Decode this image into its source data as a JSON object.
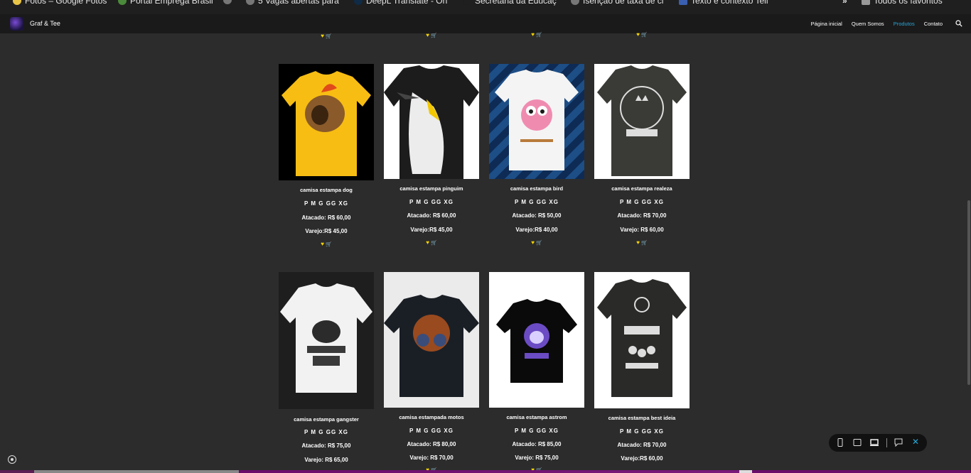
{
  "bookmarks": [
    {
      "label": "Fotos – Google Fotos"
    },
    {
      "label": "Portal Emprega Brasil"
    },
    {
      "label": ""
    },
    {
      "label": "5 Vagas abertas para"
    },
    {
      "label": "DeepL Translate - On"
    },
    {
      "label": "Secretaria da Educaç"
    },
    {
      "label": "Isenção de taxa de ci"
    },
    {
      "label": "Texto e contexto Teli"
    }
  ],
  "bookmarks_more": "»",
  "all_bookmarks": "Todos os favoritos",
  "site": {
    "brand": "Graf & Tee"
  },
  "nav": [
    {
      "label": "Página inicial",
      "active": false
    },
    {
      "label": "Quem Somos",
      "active": false
    },
    {
      "label": "Produtos",
      "active": true
    },
    {
      "label": "Contato",
      "active": false
    }
  ],
  "products": [
    {
      "name": "camisa estampa dog",
      "sizes": "P M G GG XG",
      "atacado": "Atacado: R$ 60,00",
      "varejo": "Varejo:R$ 45,00",
      "image": "yellow-tshirt-dog-print"
    },
    {
      "name": "camisa estampa pinguim",
      "sizes": "P M G GG XG",
      "atacado": "Atacado: R$ 60,00",
      "varejo": "Varejo:R$ 45,00",
      "image": "black-tshirt-penguin-print"
    },
    {
      "name": "camisa estampa bird",
      "sizes": "P M G GG XG",
      "atacado": "Atacado: R$ 50,00",
      "varejo": "Varejo:R$ 40,00",
      "image": "white-tshirt-bird-print"
    },
    {
      "name": "camisa estampa realeza",
      "sizes": "P M G GG XG",
      "atacado": "Atacado: R$ 70,00",
      "varejo": "Varejo: R$ 60,00",
      "image": "dark-tshirt-imperial-print"
    },
    {
      "name": "camisa estampa gangster",
      "sizes": "P M G GG XG",
      "atacado": "Atacado: R$ 75,00",
      "varejo": "Varejo: R$ 65,00",
      "image": "white-tshirt-gangster-print"
    },
    {
      "name": "camisa estampada motos",
      "sizes": "P M G GG XG",
      "atacado": "Atacado: R$ 80,00",
      "varejo": "Varejo: R$ 70,00",
      "image": "black-tshirt-motorcycles-print"
    },
    {
      "name": "camisa estampa astrom",
      "sizes": "P M G GG XG",
      "atacado": "Atacado: R$ 85,00",
      "varejo": "Varejo: R$ 75,00",
      "image": "black-tshirt-astronaut-print"
    },
    {
      "name": "camisa estampa best ideia",
      "sizes": "P M G GG XG",
      "atacado": "Atacado: R$ 70,00",
      "varejo": "Varejo:R$ 60,00",
      "image": "dark-tshirt-best-idea-print"
    }
  ],
  "icons": {
    "heart": "heart-icon",
    "cart": "cart-icon",
    "search": "search-icon",
    "camera": "camera-icon"
  },
  "colors": {
    "accent": "#2aa6d6",
    "heart": "#f5d400",
    "background": "#2c2c2c",
    "navbar": "#1a1a1a"
  },
  "glyphs": {
    "heart": "♥",
    "cart": "🛒",
    "close": "✕"
  }
}
